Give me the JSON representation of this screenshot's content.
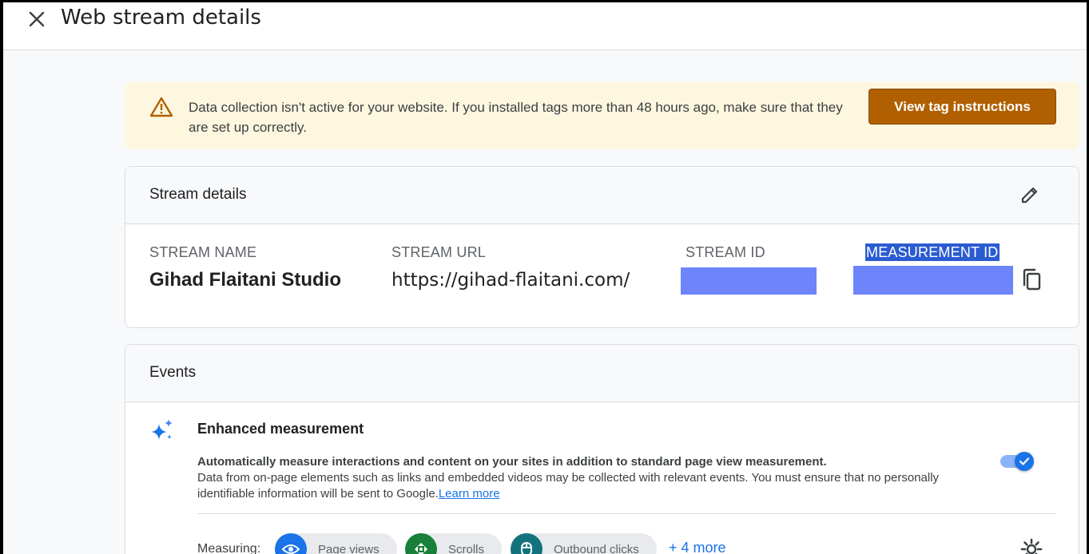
{
  "header": {
    "title": "Web stream details"
  },
  "banner": {
    "message": "Data collection isn't active for your website. If you installed tags more than 48 hours ago, make sure that they are set up correctly.",
    "button_label": "View tag instructions",
    "icon": "warning-icon",
    "accent": "#b06000",
    "background": "#fef7e0"
  },
  "stream_details": {
    "title": "Stream details",
    "fields": {
      "stream_name_label": "STREAM NAME",
      "stream_name": "Gihad Flaitani Studio",
      "stream_url_label": "STREAM URL",
      "stream_url": "https://gihad-flaitani.com/",
      "stream_id_label": "STREAM ID",
      "measurement_id_label": "MEASUREMENT ID"
    },
    "redaction_color": "#6d84fb"
  },
  "events": {
    "title": "Events",
    "enhanced_title": "Enhanced measurement",
    "enhanced_desc_strong": "Automatically measure interactions and content on your sites in addition to standard page view measurement.",
    "enhanced_desc": "Data from on-page elements such as links and embedded videos may be collected with relevant events. You must ensure that no personally identifiable information will be sent to Google.",
    "learn_more": "Learn more",
    "toggle_on": true,
    "measuring_label": "Measuring:",
    "chips": [
      {
        "label": "Page views",
        "icon": "eye-icon",
        "color": "#1a73e8"
      },
      {
        "label": "Scrolls",
        "icon": "scroll-icon",
        "color": "#188038"
      },
      {
        "label": "Outbound clicks",
        "icon": "mouse-icon",
        "color": "#12737d"
      }
    ],
    "more": "+ 4 more"
  }
}
